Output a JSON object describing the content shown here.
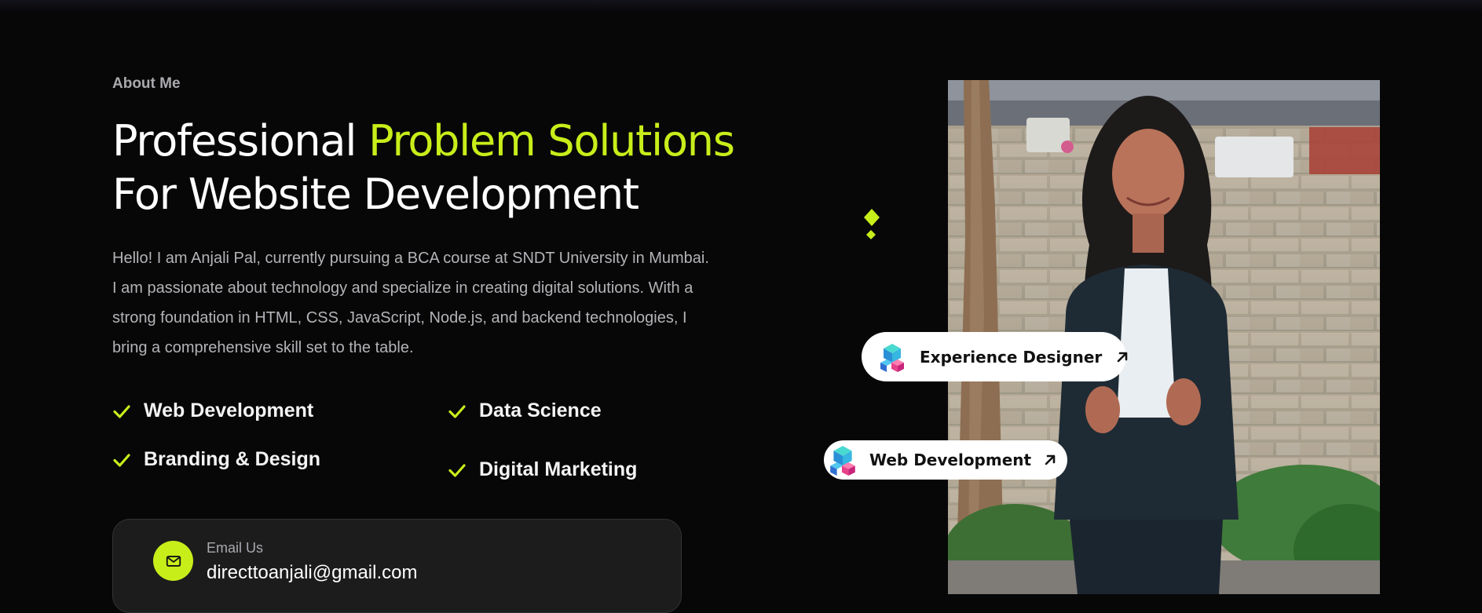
{
  "about": {
    "eyebrow": "About Me",
    "headline": {
      "part1": "Professional ",
      "accent": "Problem Solutions",
      "line2": "For Website Development"
    },
    "bio": "Hello! I am Anjali Pal, currently pursuing a BCA course at SNDT University in Mumbai. I am passionate about technology and specialize in creating digital solutions. With a strong foundation in HTML, CSS, JavaScript, Node.js, and backend technologies, I bring a comprehensive skill set to the table.",
    "features": [
      {
        "label": "Web Development",
        "icon": "check-icon"
      },
      {
        "label": "Data Science",
        "icon": "check-icon"
      },
      {
        "label": "Branding & Design",
        "icon": "check-icon"
      },
      {
        "label": "Digital Marketing",
        "icon": "check-icon"
      }
    ],
    "email": {
      "label": "Email Us",
      "value": "directtoanjali@gmail.com",
      "icon": "mail-icon"
    }
  },
  "badges": [
    {
      "label": "Experience Designer",
      "icon": "cubes-icon",
      "arrow": "arrow-up-right-icon"
    },
    {
      "label": "Web Development",
      "icon": "cubes-icon",
      "arrow": "arrow-up-right-icon"
    }
  ],
  "colors": {
    "background": "#070708",
    "accent": "#c8ee1a",
    "muted_text": "#b4b4b8",
    "card": "#1c1c1d"
  }
}
